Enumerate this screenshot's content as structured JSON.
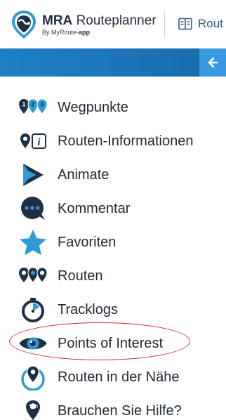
{
  "header": {
    "brand_name": "MRA",
    "brand_product": "Routeplanner",
    "brand_sub_prefix": "By MyRoute-",
    "brand_sub_bold": "app",
    "tab_label": "Rout",
    "tab_icon": "map-book-icon",
    "logo_icon": "mra-logo-icon"
  },
  "toolbar": {
    "collapse_icon": "arrow-left-icon"
  },
  "colors": {
    "accent_dark": "#1b73b8",
    "accent_light": "#3a9ae0",
    "icon_dark": "#1f2f44",
    "icon_blue": "#2f9bd6",
    "highlight": "#d42a2a"
  },
  "menu": {
    "items": [
      {
        "id": "wegpunkte",
        "label": "Wegpunkte",
        "icon": "waypoints-icon"
      },
      {
        "id": "routen-informationen",
        "label": "Routen-Informationen",
        "icon": "route-info-icon"
      },
      {
        "id": "animate",
        "label": "Animate",
        "icon": "play-animate-icon"
      },
      {
        "id": "kommentar",
        "label": "Kommentar",
        "icon": "comment-icon"
      },
      {
        "id": "favoriten",
        "label": "Favoriten",
        "icon": "star-icon"
      },
      {
        "id": "routen",
        "label": "Routen",
        "icon": "routes-pins-icon"
      },
      {
        "id": "tracklogs",
        "label": "Tracklogs",
        "icon": "stopwatch-icon"
      },
      {
        "id": "points-of-interest",
        "label": "Points of Interest",
        "icon": "eye-icon",
        "highlighted": true
      },
      {
        "id": "routen-in-der-naehe",
        "label": "Routen in der Nähe",
        "icon": "nearby-pin-icon"
      },
      {
        "id": "brauchen-sie-hilfe",
        "label": "Brauchen Sie Hilfe?",
        "icon": "help-pin-icon"
      }
    ]
  }
}
